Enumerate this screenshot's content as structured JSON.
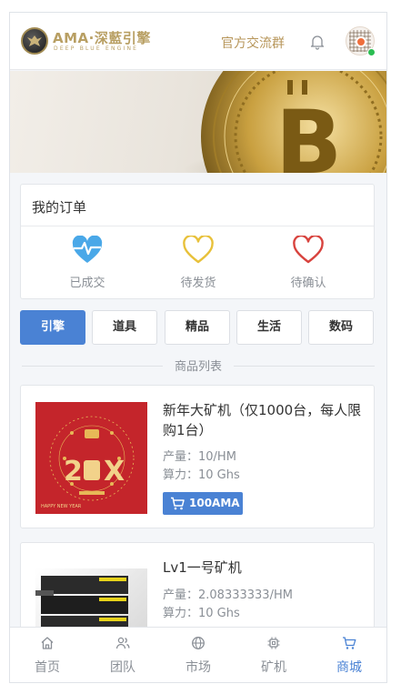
{
  "header": {
    "brand_title": "AMA·深藍引擎",
    "brand_subtitle": "DEEP BLUE ENGINE",
    "group_link": "官方交流群",
    "bell_icon": "bell-icon",
    "avatar_icon": "qr-avatar-icon",
    "accent_color": "#b89f63"
  },
  "banner": {
    "image": "bitcoin-coin-photo"
  },
  "orders": {
    "title": "我的订单",
    "items": [
      {
        "label": "已成交",
        "icon": "heartbeat-icon",
        "color": "#4aa8e8"
      },
      {
        "label": "待发货",
        "icon": "heart-outline-icon",
        "color": "#e8c13a"
      },
      {
        "label": "待确认",
        "icon": "heart-outline-icon",
        "color": "#d8433e"
      }
    ]
  },
  "tabs": [
    {
      "label": "引擎",
      "active": true
    },
    {
      "label": "道具",
      "active": false
    },
    {
      "label": "精品",
      "active": false
    },
    {
      "label": "生活",
      "active": false
    },
    {
      "label": "数码",
      "active": false
    }
  ],
  "section_title": "商品列表",
  "products": [
    {
      "name": "新年大矿机（仅1000台，每人限购1台）",
      "output": "产量：10/HM",
      "power": "算力：10 Ghs",
      "price": "100AMA",
      "image_text": "2019 HAPPY NEW YEAR OF XXXXXX"
    },
    {
      "name": "Lv1一号矿机",
      "output": "产量：2.08333333/HM",
      "power": "算力：10 Ghs"
    }
  ],
  "bottom_nav": [
    {
      "label": "首页",
      "icon": "home-icon",
      "active": false
    },
    {
      "label": "团队",
      "icon": "team-icon",
      "active": false
    },
    {
      "label": "市场",
      "icon": "globe-icon",
      "active": false
    },
    {
      "label": "矿机",
      "icon": "chip-icon",
      "active": false
    },
    {
      "label": "商城",
      "icon": "cart-icon",
      "active": true
    }
  ],
  "colors": {
    "primary": "#4a82d4",
    "gold": "#b7965a",
    "muted": "#8a8f96",
    "online": "#2bbd52"
  }
}
